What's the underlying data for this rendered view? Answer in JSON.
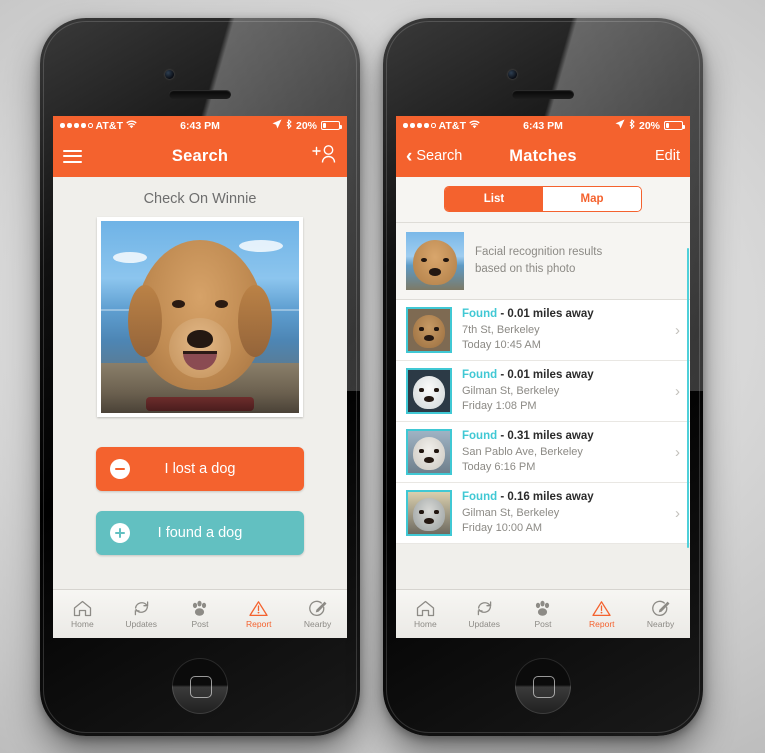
{
  "status_bar": {
    "carrier": "AT&T",
    "time": "6:43 PM",
    "battery": "20%",
    "signal_dots_filled": 4,
    "signal_dots_total": 5,
    "icons": [
      "wifi-icon",
      "location-arrow-icon",
      "bluetooth-icon",
      "battery-icon"
    ]
  },
  "left_phone": {
    "nav": {
      "menu_icon": "hamburger-menu-icon",
      "title": "Search",
      "action_icon": "add-person-icon"
    },
    "page_title": "Check On Winnie",
    "photo_alt": "dog-photo",
    "buttons": [
      {
        "label": "I lost a dog",
        "icon": "minus-circle-icon",
        "color": "#f4622e"
      },
      {
        "label": "I found a dog",
        "icon": "plus-circle-icon",
        "color": "#62c0c1"
      }
    ],
    "tabs": [
      {
        "label": "Home",
        "icon": "home-icon",
        "active": false
      },
      {
        "label": "Updates",
        "icon": "refresh-icon",
        "active": false
      },
      {
        "label": "Post",
        "icon": "paw-icon",
        "active": false
      },
      {
        "label": "Report",
        "icon": "warning-triangle-icon",
        "active": true
      },
      {
        "label": "Nearby",
        "icon": "compass-pen-icon",
        "active": false
      }
    ]
  },
  "right_phone": {
    "nav": {
      "back_icon": "chevron-left-icon",
      "back_label": "Search",
      "title": "Matches",
      "edit_label": "Edit"
    },
    "segmented": {
      "options": [
        "List",
        "Map"
      ],
      "selected": "List"
    },
    "banner": {
      "thumb_alt": "reference-dog-photo",
      "text_line1": "Facial recognition results",
      "text_line2": "based on this photo"
    },
    "matches": [
      {
        "status": "Found",
        "distance": "- 0.01 miles away",
        "location": "7th St, Berkeley",
        "time": "Today 10:45 AM",
        "thumb_alt": "golden-doodle-thumb"
      },
      {
        "status": "Found",
        "distance": "- 0.01 miles away",
        "location": "Gilman St, Berkeley",
        "time": "Friday 1:08 PM",
        "thumb_alt": "white-maltese-thumb"
      },
      {
        "status": "Found",
        "distance": "- 0.31 miles away",
        "location": "San Pablo Ave, Berkeley",
        "time": "Today 6:16 PM",
        "thumb_alt": "white-brown-terrier-thumb"
      },
      {
        "status": "Found",
        "distance": "- 0.16 miles away",
        "location": "Gilman St, Berkeley",
        "time": "Friday 10:00 AM",
        "thumb_alt": "grey-white-dog-thumb"
      }
    ],
    "chevron_icon": "chevron-right-icon",
    "tabs": [
      {
        "label": "Home",
        "icon": "home-icon",
        "active": false
      },
      {
        "label": "Updates",
        "icon": "refresh-icon",
        "active": false
      },
      {
        "label": "Post",
        "icon": "paw-icon",
        "active": false
      },
      {
        "label": "Report",
        "icon": "warning-triangle-icon",
        "active": true
      },
      {
        "label": "Nearby",
        "icon": "compass-pen-icon",
        "active": false
      }
    ]
  },
  "colors": {
    "orange": "#f4622e",
    "teal": "#40c8d4",
    "button_teal": "#62c0c1",
    "screen_bg": "#f0efeb"
  }
}
